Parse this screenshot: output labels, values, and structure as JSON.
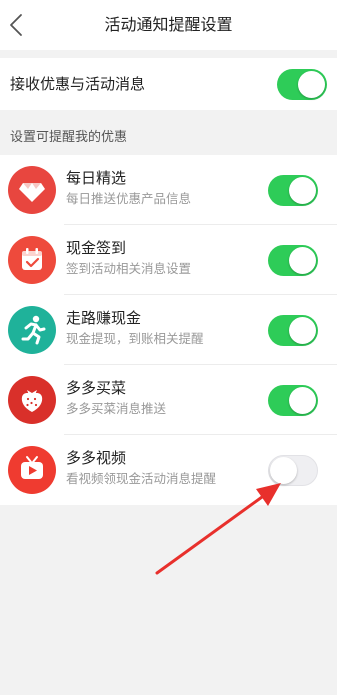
{
  "header": {
    "title": "活动通知提醒设置"
  },
  "master": {
    "label": "接收优惠与活动消息",
    "enabled": true
  },
  "section": {
    "title": "设置可提醒我的优惠"
  },
  "items": [
    {
      "title": "每日精选",
      "subtitle": "每日推送优惠产品信息",
      "icon": "diamond-icon",
      "color": "#e8463f",
      "enabled": true
    },
    {
      "title": "现金签到",
      "subtitle": "签到活动相关消息设置",
      "icon": "calendar-check-icon",
      "color": "#ee4a3c",
      "enabled": true
    },
    {
      "title": "走路赚现金",
      "subtitle": "现金提现，到账相关提醒",
      "icon": "running-person-icon",
      "color": "#1fb29a",
      "enabled": true
    },
    {
      "title": "多多买菜",
      "subtitle": "多多买菜消息推送",
      "icon": "strawberry-icon",
      "color": "#d9302a",
      "enabled": true
    },
    {
      "title": "多多视频",
      "subtitle": "看视频领现金活动消息提醒",
      "icon": "video-play-icon",
      "color": "#ef3b30",
      "enabled": false
    }
  ],
  "colors": {
    "toggle_on": "#2ecc58",
    "toggle_off": "#efeff2",
    "annotation_arrow": "#e8302c"
  }
}
